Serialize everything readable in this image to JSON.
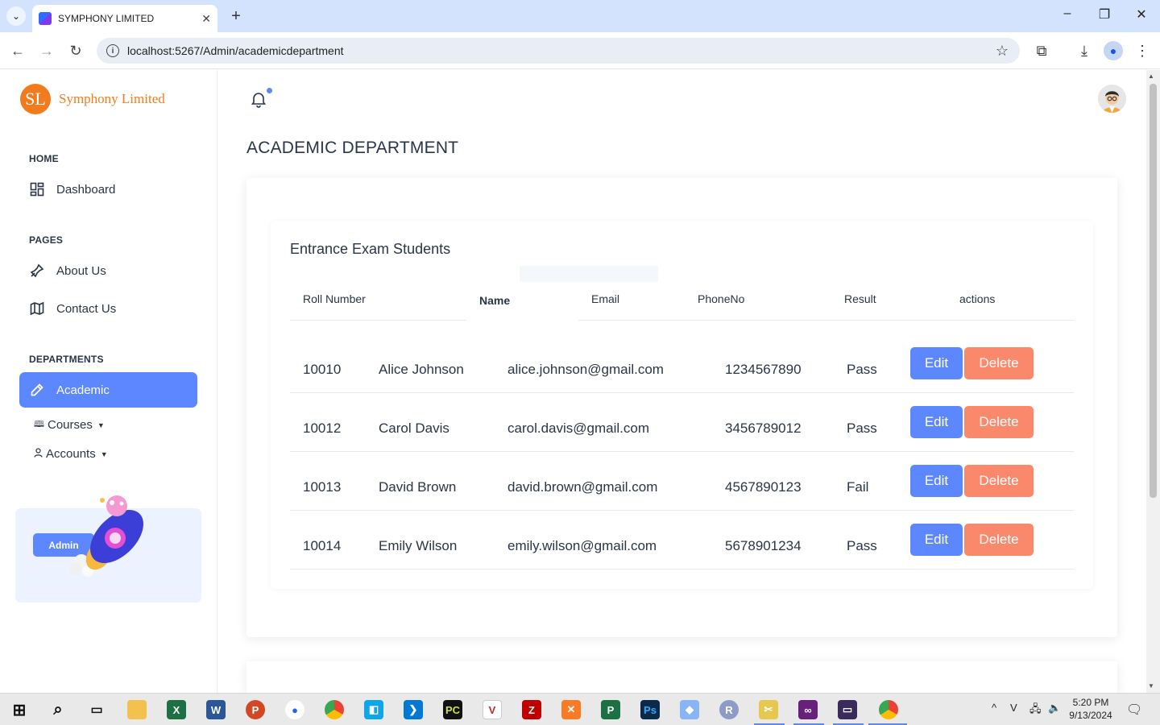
{
  "browser": {
    "tab_title": "SYMPHONY LIMITED",
    "url": "localhost:5267/Admin/academicdepartment"
  },
  "brand": {
    "logo_initials": "SL",
    "name": "Symphony Limited",
    "color": "#f27c1d"
  },
  "sidebar": {
    "sections": [
      {
        "label": "HOME",
        "items": [
          {
            "label": "Dashboard",
            "icon": "dashboard-grid-icon"
          }
        ]
      },
      {
        "label": "PAGES",
        "items": [
          {
            "label": "About Us",
            "icon": "pin-icon"
          },
          {
            "label": "Contact Us",
            "icon": "map-icon"
          }
        ]
      },
      {
        "label": "DEPARTMENTS",
        "items": [
          {
            "label": "Academic",
            "icon": "pencil-icon",
            "active": true
          }
        ]
      }
    ],
    "dropdowns": [
      {
        "label": "Courses",
        "icon": "book-icon"
      },
      {
        "label": "Accounts",
        "icon": "user-icon"
      }
    ],
    "promo_button": "Admin"
  },
  "page": {
    "title": "ACADEMIC DEPARTMENT",
    "card_title": "Entrance Exam Students"
  },
  "table": {
    "headers": [
      "Roll Number",
      "Name",
      "Email",
      "PhoneNo",
      "Result",
      "actions"
    ],
    "rows": [
      {
        "roll": "10010",
        "name": "Alice Johnson",
        "email": "alice.johnson@gmail.com",
        "phone": "1234567890",
        "result": "Pass"
      },
      {
        "roll": "10012",
        "name": "Carol Davis",
        "email": "carol.davis@gmail.com",
        "phone": "3456789012",
        "result": "Pass"
      },
      {
        "roll": "10013",
        "name": "David Brown",
        "email": "david.brown@gmail.com",
        "phone": "4567890123",
        "result": "Fail"
      },
      {
        "roll": "10014",
        "name": "Emily Wilson",
        "email": "emily.wilson@gmail.com",
        "phone": "5678901234",
        "result": "Pass"
      }
    ],
    "edit_label": "Edit",
    "delete_label": "Delete"
  },
  "colors": {
    "primary": "#5d87ff",
    "danger": "#fa896b",
    "text": "#2a3547"
  },
  "taskbar": {
    "time": "5:20 PM",
    "date": "9/13/2024"
  }
}
